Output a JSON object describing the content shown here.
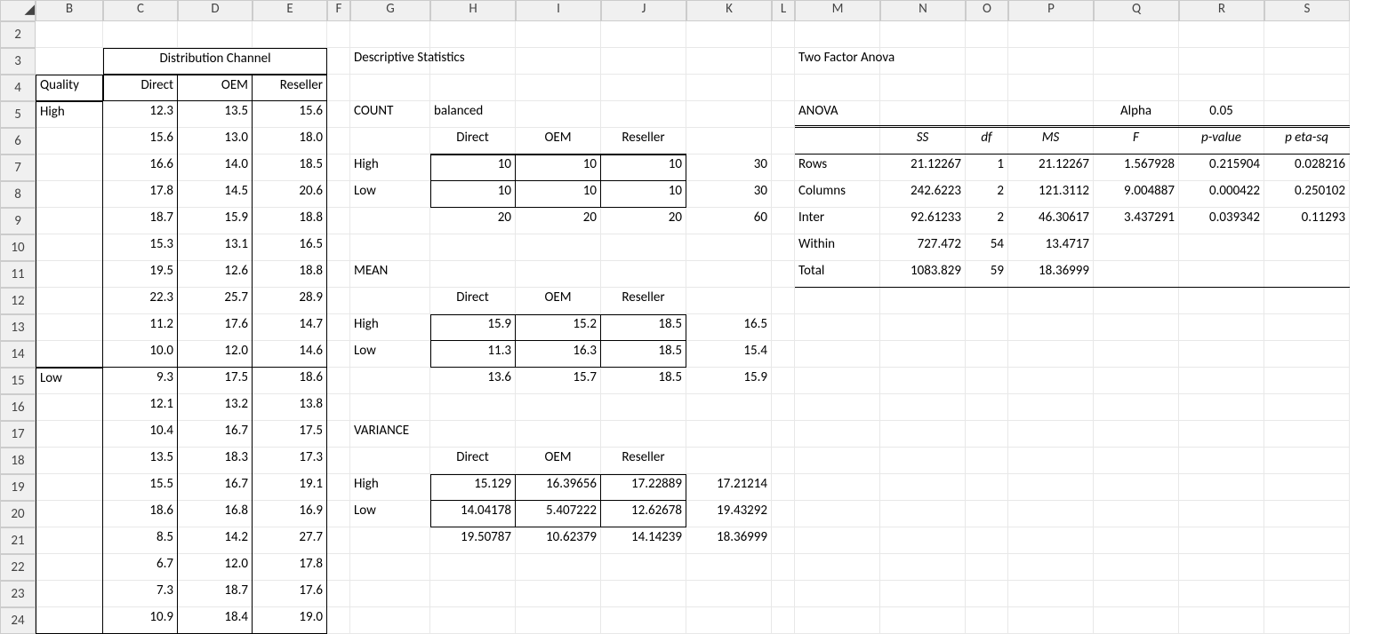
{
  "cols": [
    "B",
    "C",
    "D",
    "E",
    "F",
    "G",
    "H",
    "I",
    "J",
    "K",
    "L",
    "M",
    "N",
    "O",
    "P",
    "Q",
    "R",
    "S"
  ],
  "rows": [
    "2",
    "3",
    "4",
    "5",
    "6",
    "7",
    "8",
    "9",
    "10",
    "11",
    "12",
    "13",
    "14",
    "15",
    "16",
    "17",
    "18",
    "19",
    "20",
    "21",
    "22",
    "23",
    "24"
  ],
  "label": {
    "dist": "Distribution Channel",
    "quality": "Quality",
    "direct": "Direct",
    "oem": "OEM",
    "reseller": "Reseller",
    "high": "High",
    "low": "Low",
    "desc": "Descriptive Statistics",
    "count": "COUNT",
    "balanced": "balanced",
    "mean": "MEAN",
    "variance": "VARIANCE",
    "tfa": "Two Factor Anova",
    "anova": "ANOVA",
    "alpha": "Alpha",
    "alpha_val": "0.05",
    "ss": "SS",
    "df": "df",
    "ms": "MS",
    "F": "F",
    "pv": "p-value",
    "peta": "p eta-sq",
    "rowsL": "Rows",
    "colsL": "Columns",
    "inter": "Inter",
    "within": "Within",
    "total": "Total"
  },
  "data": {
    "C5": "12.3",
    "D5": "13.5",
    "E5": "15.6",
    "C6": "15.6",
    "D6": "13.0",
    "E6": "18.0",
    "C7": "16.6",
    "D7": "14.0",
    "E7": "18.5",
    "C8": "17.8",
    "D8": "14.5",
    "E8": "20.6",
    "C9": "18.7",
    "D9": "15.9",
    "E9": "18.8",
    "C10": "15.3",
    "D10": "13.1",
    "E10": "16.5",
    "C11": "19.5",
    "D11": "12.6",
    "E11": "18.8",
    "C12": "22.3",
    "D12": "25.7",
    "E12": "28.9",
    "C13": "11.2",
    "D13": "17.6",
    "E13": "14.7",
    "C14": "10.0",
    "D14": "12.0",
    "E14": "14.6",
    "C15": "9.3",
    "D15": "17.5",
    "E15": "18.6",
    "C16": "12.1",
    "D16": "13.2",
    "E16": "13.8",
    "C17": "10.4",
    "D17": "16.7",
    "E17": "17.5",
    "C18": "13.5",
    "D18": "18.3",
    "E18": "17.3",
    "C19": "15.5",
    "D19": "16.7",
    "E19": "19.1",
    "C20": "18.6",
    "D20": "16.8",
    "E20": "16.9",
    "C21": "8.5",
    "D21": "14.2",
    "E21": "27.7",
    "C22": "6.7",
    "D22": "12.0",
    "E22": "17.8",
    "C23": "7.3",
    "D23": "18.7",
    "E23": "17.6",
    "C24": "10.9",
    "D24": "18.4",
    "E24": "19.0"
  },
  "count": {
    "H7": "10",
    "I7": "10",
    "J7": "10",
    "K7": "30",
    "H8": "10",
    "I8": "10",
    "J8": "10",
    "K8": "30",
    "H9": "20",
    "I9": "20",
    "J9": "20",
    "K9": "60"
  },
  "mean": {
    "H13": "15.9",
    "I13": "15.2",
    "J13": "18.5",
    "K13": "16.5",
    "H14": "11.3",
    "I14": "16.3",
    "J14": "18.5",
    "K14": "15.4",
    "H15": "13.6",
    "I15": "15.7",
    "J15": "18.5",
    "K15": "15.9"
  },
  "variance": {
    "H19": "15.129",
    "I19": "16.39656",
    "J19": "17.22889",
    "K19": "17.21214",
    "H20": "14.04178",
    "I20": "5.407222",
    "J20": "12.62678",
    "K20": "19.43292",
    "H21": "19.50787",
    "I21": "10.62379",
    "J21": "14.14239",
    "K21": "18.36999"
  },
  "anova": {
    "N7": "21.12267",
    "O7": "1",
    "P7": "21.12267",
    "Q7": "1.567928",
    "R7": "0.215904",
    "S7": "0.028216",
    "N8": "242.6223",
    "O8": "2",
    "P8": "121.3112",
    "Q8": "9.004887",
    "R8": "0.000422",
    "S8": "0.250102",
    "N9": "92.61233",
    "O9": "2",
    "P9": "46.30617",
    "Q9": "3.437291",
    "R9": "0.039342",
    "S9": "0.11293",
    "N10": "727.472",
    "O10": "54",
    "P10": "13.4717",
    "N11": "1083.829",
    "O11": "59",
    "P11": "18.36999"
  }
}
